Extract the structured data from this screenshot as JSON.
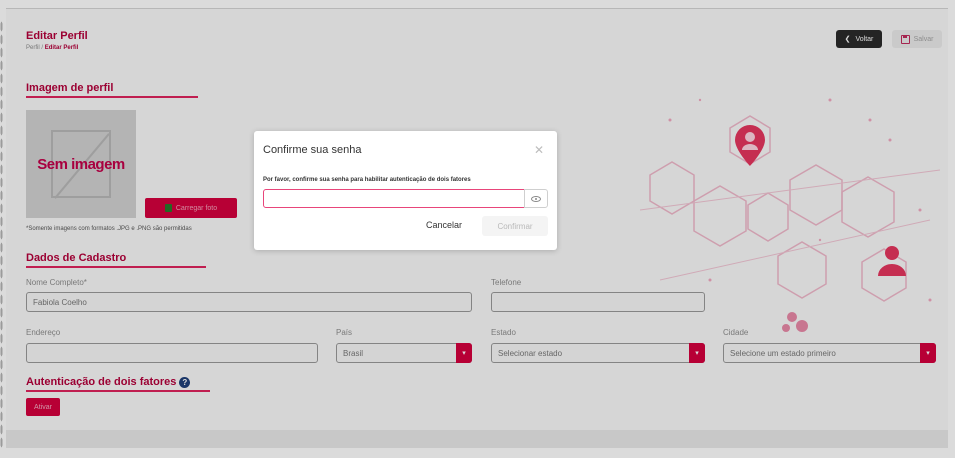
{
  "header": {
    "title": "Editar Perfil",
    "breadcrumb_parent": "Perfil",
    "breadcrumb_separator": " / ",
    "breadcrumb_current": "Editar Perfil",
    "back_label": "Voltar",
    "save_label": "Salvar"
  },
  "profile_image": {
    "section_title": "Imagem de perfil",
    "placeholder_text": "Sem imagem",
    "upload_label": "Carregar foto",
    "hint": "*Somente imagens com formatos .JPG e .PNG são permitidas"
  },
  "registration": {
    "section_title": "Dados de Cadastro",
    "full_name_label": "Nome Completo*",
    "full_name_value": "Fabiola Coelho",
    "phone_label": "Telefone",
    "phone_value": "",
    "address_label": "Endereço",
    "address_value": "",
    "country_label": "País",
    "country_value": "Brasil",
    "state_label": "Estado",
    "state_value": "Selecionar estado",
    "city_label": "Cidade",
    "city_value": "Selecione um estado primeiro"
  },
  "two_factor": {
    "section_title": "Autenticação de dois fatores",
    "activate_label": "Ativar"
  },
  "modal": {
    "title": "Confirme sua senha",
    "message": "Por favor, confirme sua senha para habilitar autenticação de dois fatores",
    "password_value": "",
    "cancel_label": "Cancelar",
    "confirm_label": "Confirmar"
  },
  "colors": {
    "accent": "#d6003e",
    "title": "#b5003b",
    "help_icon": "#1f3f7a"
  },
  "icons": {
    "back": "chevron-left-icon",
    "save": "floppy-disk-icon",
    "upload": "upload-icon",
    "help": "question-circle-icon",
    "close": "close-icon",
    "password_toggle": "eye-icon",
    "select": "caret-down-icon"
  }
}
